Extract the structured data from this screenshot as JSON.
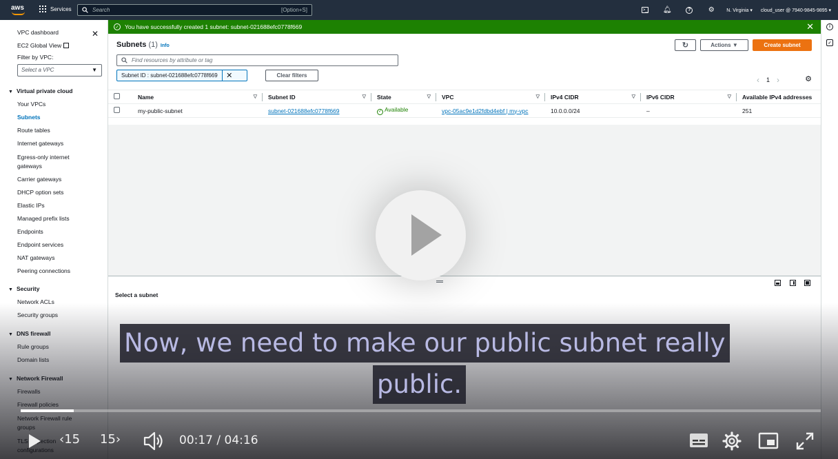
{
  "topnav": {
    "logo": "aws",
    "services_label": "Services",
    "search_placeholder": "Search",
    "search_shortcut": "[Option+S]",
    "region": "N. Virginia",
    "account": "cloud_user @ 7940-9845-9895"
  },
  "sidebar": {
    "dashboard": "VPC dashboard",
    "ec2_global": "EC2 Global View",
    "filter_label": "Filter by VPC:",
    "filter_placeholder": "Select a VPC",
    "sections": [
      {
        "title": "Virtual private cloud",
        "items": [
          "Your VPCs",
          "Subnets",
          "Route tables",
          "Internet gateways",
          "Egress-only internet gateways",
          "Carrier gateways",
          "DHCP option sets",
          "Elastic IPs",
          "Managed prefix lists",
          "Endpoints",
          "Endpoint services",
          "NAT gateways",
          "Peering connections"
        ]
      },
      {
        "title": "Security",
        "items": [
          "Network ACLs",
          "Security groups"
        ]
      },
      {
        "title": "DNS firewall",
        "items": [
          "Rule groups",
          "Domain lists"
        ]
      },
      {
        "title": "Network Firewall",
        "items": [
          "Firewalls",
          "Firewall policies",
          "Network Firewall rule groups",
          "TLS inspection configurations"
        ]
      }
    ],
    "active_item": "Subnets"
  },
  "flash": {
    "message": "You have successfully created 1 subnet: subnet-021688efc0778f669"
  },
  "subnets": {
    "title": "Subnets",
    "count": "(1)",
    "info": "Info",
    "actions_label": "Actions",
    "create_label": "Create subnet",
    "find_placeholder": "Find resources by attribute or tag",
    "filter_token": "Subnet ID : subnet-021688efc0778f669",
    "clear_filters": "Clear filters",
    "page": "1",
    "columns": [
      "Name",
      "Subnet ID",
      "State",
      "VPC",
      "IPv4 CIDR",
      "IPv6 CIDR",
      "Available IPv4 addresses"
    ],
    "rows": [
      {
        "name": "my-public-subnet",
        "subnet_id": "subnet-021688efc0778f669",
        "state": "Available",
        "vpc": "vpc-05ac9e1d2fdbd4ebf | my-vpc",
        "ipv4": "10.0.0.0/24",
        "ipv6": "–",
        "available": "251"
      }
    ]
  },
  "detail": {
    "placeholder": "Select a subnet"
  },
  "video": {
    "caption_line1": "Now, we need to make our public subnet really",
    "caption_line2": "public.",
    "back_label": "15",
    "fwd_label": "15",
    "time": "00:17 / 04:16",
    "progress": 0.066
  }
}
